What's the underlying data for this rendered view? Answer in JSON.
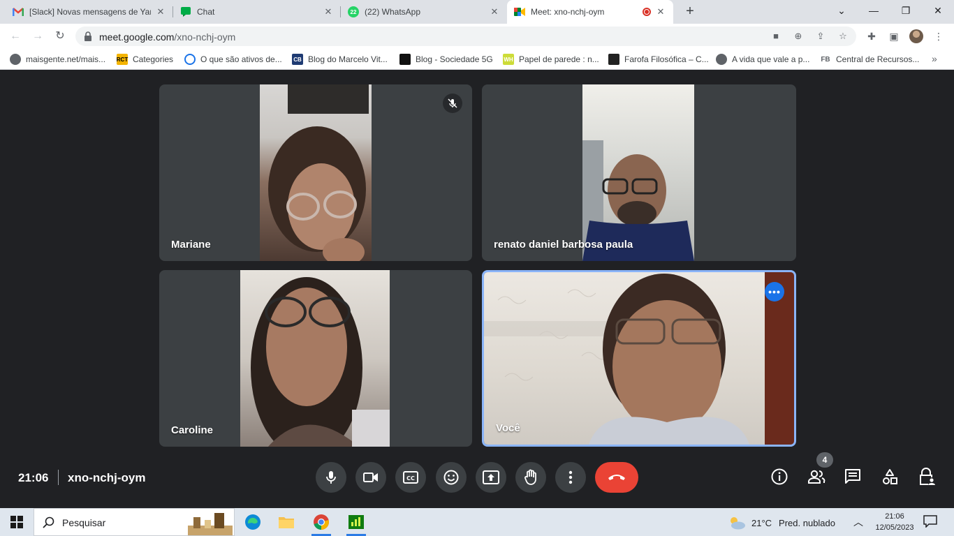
{
  "browser": {
    "tabs": [
      {
        "title": "[Slack] Novas mensagens de Yan",
        "favicon": "gmail-icon"
      },
      {
        "title": "Chat",
        "favicon": "google-chat-icon"
      },
      {
        "title": "(22) WhatsApp",
        "favicon": "whatsapp-icon",
        "badge": "22"
      },
      {
        "title": "Meet: xno-nchj-oym",
        "favicon": "meet-icon",
        "active": true
      }
    ],
    "url_host": "meet.google.com",
    "url_path": "/xno-nchj-oym",
    "bookmarks": [
      {
        "label": "maisgente.net/mais...",
        "icon": "globe-icon"
      },
      {
        "label": "Categories",
        "icon": "rct-icon",
        "icon_text": "RCT"
      },
      {
        "label": "O que são ativos de...",
        "icon": "list-icon"
      },
      {
        "label": "Blog do Marcelo Vit...",
        "icon": "cb-icon",
        "icon_text": "CB"
      },
      {
        "label": "Blog - Sociedade 5G",
        "icon": "blog-icon"
      },
      {
        "label": "Papel de parede : n...",
        "icon": "wh-icon",
        "icon_text": "WH"
      },
      {
        "label": "Farofa Filosófica – C...",
        "icon": "farofa-icon"
      },
      {
        "label": "A vida que vale a p...",
        "icon": "globe-icon"
      },
      {
        "label": "Central de Recursos...",
        "icon": "fb-icon",
        "icon_text": "FB"
      }
    ]
  },
  "meet": {
    "participants": [
      {
        "name": "Mariane",
        "muted": true
      },
      {
        "name": "renato daniel barbosa paula"
      },
      {
        "name": "Caroline"
      },
      {
        "name": "Você",
        "is_self": true
      }
    ],
    "time": "21:06",
    "meeting_code": "xno-nchj-oym",
    "people_count": "4",
    "colors": {
      "hangup": "#ea4335",
      "highlight": "#8ab4f8",
      "accent": "#1a73e8"
    }
  },
  "taskbar": {
    "search_placeholder": "Pesquisar",
    "temperature": "21°C",
    "weather": "Pred. nublado",
    "time": "21:06",
    "date": "12/05/2023"
  }
}
